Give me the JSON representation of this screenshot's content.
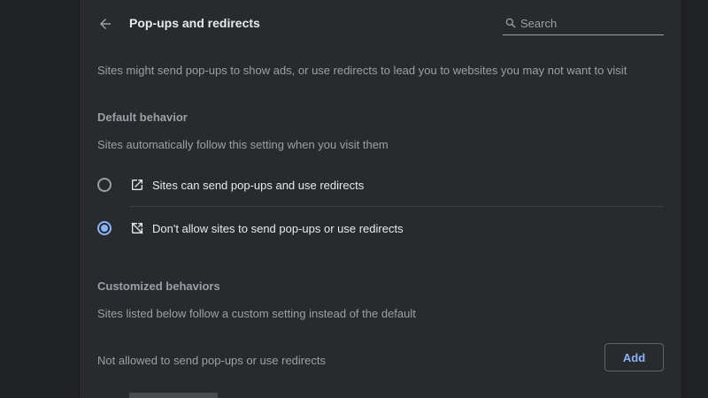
{
  "header": {
    "title": "Pop-ups and redirects",
    "back_icon": "arrow-left-icon"
  },
  "search": {
    "placeholder": "Search",
    "value": "",
    "icon": "search-icon"
  },
  "description": "Sites might send pop-ups to show ads, or use redirects to lead you to websites you may not want to visit",
  "default_behavior": {
    "heading": "Default behavior",
    "subtext": "Sites automatically follow this setting when you visit them",
    "options": [
      {
        "label": "Sites can send pop-ups and use redirects",
        "icon": "open-in-new-icon",
        "checked": false
      },
      {
        "label": "Don't allow sites to send pop-ups or use redirects",
        "icon": "popup-blocked-icon",
        "checked": true
      }
    ]
  },
  "customized_behaviors": {
    "heading": "Customized behaviors",
    "subtext": "Sites listed below follow a custom setting instead of the default",
    "not_allowed_label": "Not allowed to send pop-ups or use redirects",
    "add_label": "Add"
  },
  "colors": {
    "background": "#202124",
    "card": "#292a2d",
    "text_primary": "#e8eaed",
    "text_secondary": "#9aa0a6",
    "accent": "#8ab4f8",
    "divider": "#3c4043"
  }
}
